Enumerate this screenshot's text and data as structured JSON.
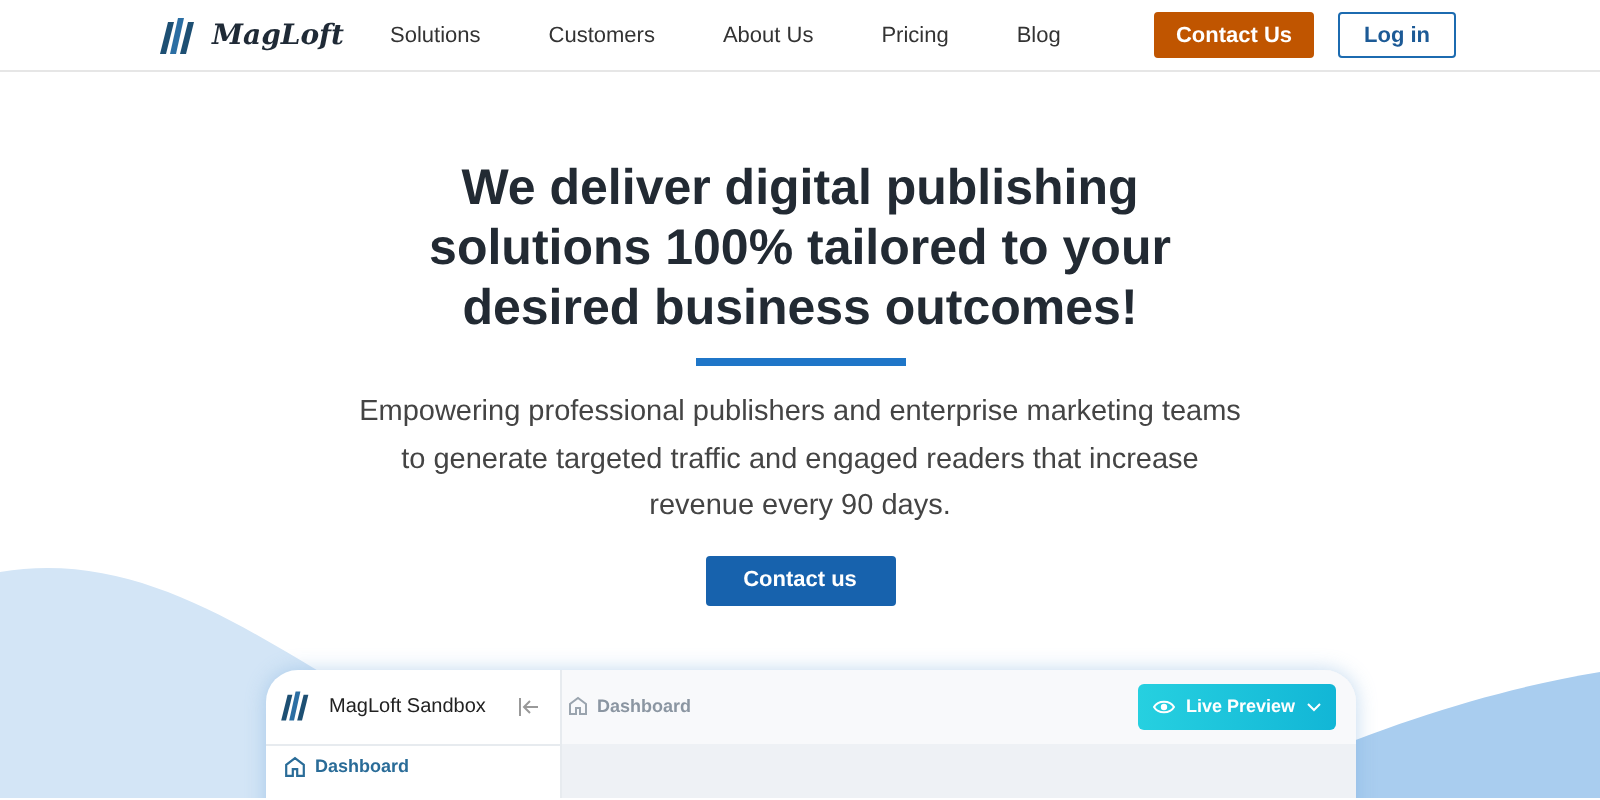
{
  "header": {
    "brand": "MagLoft",
    "nav": [
      {
        "label": "Solutions"
      },
      {
        "label": "Customers"
      },
      {
        "label": "About Us"
      },
      {
        "label": "Pricing"
      },
      {
        "label": "Blog"
      }
    ],
    "buttons": [
      {
        "label": "Contact Us",
        "kind": "primary"
      },
      {
        "label": "Log in",
        "kind": "outline"
      }
    ]
  },
  "hero": {
    "title": "We deliver digital publishing solutions 100% tailored to your desired business outcomes!",
    "subtitle": "Empowering professional publishers and enterprise marketing teams to generate targeted traffic and engaged readers that increase revenue every 90 days.",
    "button": "Contact us"
  },
  "app_preview": {
    "workspace": "MagLoft Sandbox",
    "breadcrumb": "Dashboard",
    "action": "Live Preview",
    "sidebar": {
      "items": [
        {
          "label": "Dashboard",
          "selected": true
        }
      ]
    }
  }
}
